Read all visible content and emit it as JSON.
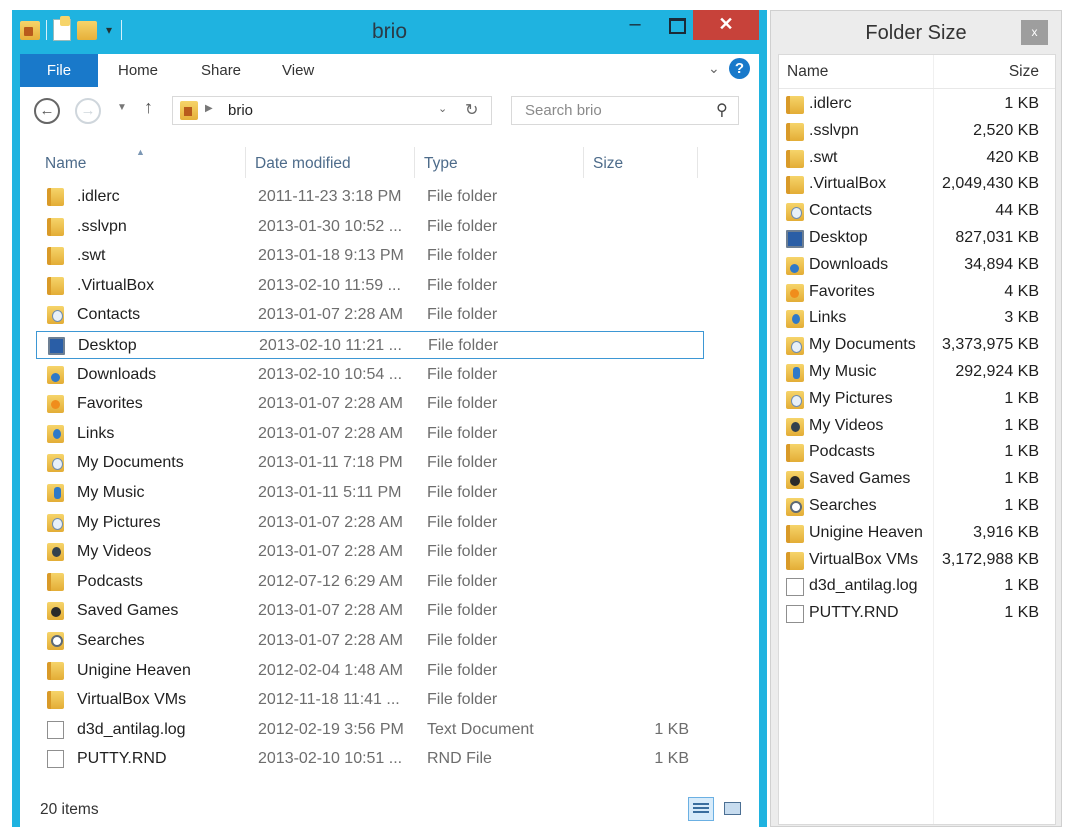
{
  "explorer": {
    "title": "brio",
    "ribbon_tabs": {
      "file": "File",
      "home": "Home",
      "share": "Share",
      "view": "View"
    },
    "help_glyph": "?",
    "address": {
      "path": "brio"
    },
    "search": {
      "placeholder": "Search brio"
    },
    "columns": {
      "name": "Name",
      "date": "Date modified",
      "type": "Type",
      "size": "Size"
    },
    "files": [
      {
        "name": ".idlerc",
        "date": "2011-11-23 3:18 PM",
        "type": "File folder",
        "size": "",
        "icon": "folder-icon"
      },
      {
        "name": ".sslvpn",
        "date": "2013-01-30 10:52 ...",
        "type": "File folder",
        "size": "",
        "icon": "folder-icon"
      },
      {
        "name": ".swt",
        "date": "2013-01-18 9:13 PM",
        "type": "File folder",
        "size": "",
        "icon": "folder-icon"
      },
      {
        "name": ".VirtualBox",
        "date": "2013-02-10 11:59 ...",
        "type": "File folder",
        "size": "",
        "icon": "folder-icon"
      },
      {
        "name": "Contacts",
        "date": "2013-01-07 2:28 AM",
        "type": "File folder",
        "size": "",
        "icon": "contacts-folder-icon"
      },
      {
        "name": "Desktop",
        "date": "2013-02-10 11:21 ...",
        "type": "File folder",
        "size": "",
        "icon": "desktop-folder-icon"
      },
      {
        "name": "Downloads",
        "date": "2013-02-10 10:54 ...",
        "type": "File folder",
        "size": "",
        "icon": "downloads-folder-icon"
      },
      {
        "name": "Favorites",
        "date": "2013-01-07 2:28 AM",
        "type": "File folder",
        "size": "",
        "icon": "favorites-folder-icon"
      },
      {
        "name": "Links",
        "date": "2013-01-07 2:28 AM",
        "type": "File folder",
        "size": "",
        "icon": "links-folder-icon"
      },
      {
        "name": "My Documents",
        "date": "2013-01-11 7:18 PM",
        "type": "File folder",
        "size": "",
        "icon": "documents-folder-icon"
      },
      {
        "name": "My Music",
        "date": "2013-01-11 5:11 PM",
        "type": "File folder",
        "size": "",
        "icon": "music-folder-icon"
      },
      {
        "name": "My Pictures",
        "date": "2013-01-07 2:28 AM",
        "type": "File folder",
        "size": "",
        "icon": "pictures-folder-icon"
      },
      {
        "name": "My Videos",
        "date": "2013-01-07 2:28 AM",
        "type": "File folder",
        "size": "",
        "icon": "videos-folder-icon"
      },
      {
        "name": "Podcasts",
        "date": "2012-07-12 6:29 AM",
        "type": "File folder",
        "size": "",
        "icon": "folder-icon"
      },
      {
        "name": "Saved Games",
        "date": "2013-01-07 2:28 AM",
        "type": "File folder",
        "size": "",
        "icon": "saved-games-folder-icon"
      },
      {
        "name": "Searches",
        "date": "2013-01-07 2:28 AM",
        "type": "File folder",
        "size": "",
        "icon": "searches-folder-icon"
      },
      {
        "name": "Unigine Heaven",
        "date": "2012-02-04 1:48 AM",
        "type": "File folder",
        "size": "",
        "icon": "folder-icon"
      },
      {
        "name": "VirtualBox VMs",
        "date": "2012-11-18 11:41 ...",
        "type": "File folder",
        "size": "",
        "icon": "folder-icon"
      },
      {
        "name": "d3d_antilag.log",
        "date": "2012-02-19 3:56 PM",
        "type": "Text Document",
        "size": "1 KB",
        "icon": "text-document-icon"
      },
      {
        "name": "PUTTY.RND",
        "date": "2013-02-10 10:51 ...",
        "type": "RND File",
        "size": "1 KB",
        "icon": "file-icon"
      }
    ],
    "selected_file": "Desktop",
    "status": {
      "item_count": "20 items"
    }
  },
  "folder_size": {
    "title": "Folder Size",
    "close_glyph": "x",
    "columns": {
      "name": "Name",
      "size": "Size"
    },
    "rows": [
      {
        "name": ".idlerc",
        "size": "1 KB",
        "icon": "folder-icon"
      },
      {
        "name": ".sslvpn",
        "size": "2,520 KB",
        "icon": "folder-icon"
      },
      {
        "name": ".swt",
        "size": "420 KB",
        "icon": "folder-icon"
      },
      {
        "name": ".VirtualBox",
        "size": "2,049,430 KB",
        "icon": "folder-icon"
      },
      {
        "name": "Contacts",
        "size": "44 KB",
        "icon": "contacts-folder-icon"
      },
      {
        "name": "Desktop",
        "size": "827,031 KB",
        "icon": "desktop-folder-icon"
      },
      {
        "name": "Downloads",
        "size": "34,894 KB",
        "icon": "downloads-folder-icon"
      },
      {
        "name": "Favorites",
        "size": "4 KB",
        "icon": "favorites-folder-icon"
      },
      {
        "name": "Links",
        "size": "3 KB",
        "icon": "links-folder-icon"
      },
      {
        "name": "My Documents",
        "size": "3,373,975 KB",
        "icon": "documents-folder-icon"
      },
      {
        "name": "My Music",
        "size": "292,924 KB",
        "icon": "music-folder-icon"
      },
      {
        "name": "My Pictures",
        "size": "1 KB",
        "icon": "pictures-folder-icon"
      },
      {
        "name": "My Videos",
        "size": "1 KB",
        "icon": "videos-folder-icon"
      },
      {
        "name": "Podcasts",
        "size": "1 KB",
        "icon": "folder-icon"
      },
      {
        "name": "Saved Games",
        "size": "1 KB",
        "icon": "saved-games-folder-icon"
      },
      {
        "name": "Searches",
        "size": "1 KB",
        "icon": "searches-folder-icon"
      },
      {
        "name": "Unigine Heaven",
        "size": "3,916 KB",
        "icon": "folder-icon"
      },
      {
        "name": "VirtualBox VMs",
        "size": "3,172,988 KB",
        "icon": "folder-icon"
      },
      {
        "name": "d3d_antilag.log",
        "size": "1 KB",
        "icon": "text-document-icon"
      },
      {
        "name": "PUTTY.RND",
        "size": "1 KB",
        "icon": "file-icon"
      }
    ]
  },
  "colors": {
    "window_frame": "#1fb3e0",
    "file_tab": "#1979ca",
    "close_button": "#c7423a",
    "selection_border": "#3d97d4"
  }
}
